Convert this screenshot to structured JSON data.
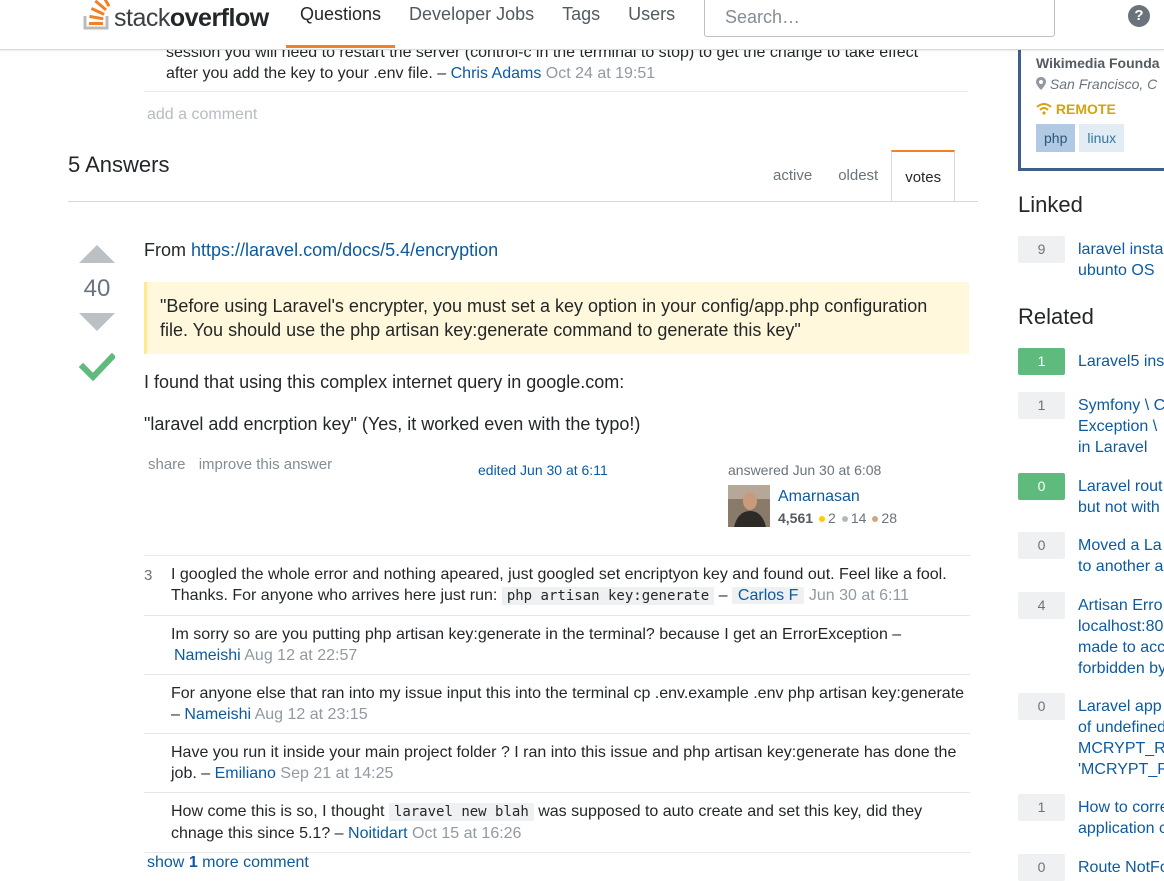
{
  "header": {
    "logo_prefix": "stack",
    "logo_bold": "overflow",
    "nav": [
      "Questions",
      "Developer Jobs",
      "Tags",
      "Users"
    ],
    "search_placeholder": "Search…",
    "help": "?"
  },
  "prev_comment": {
    "line1": "session you will need to restart the server (control-c in the terminal to stop) to get the change to take effect",
    "line2": "after you add the key to your .env file. –",
    "user": "Chris Adams",
    "time": "Oct 24 at 19:51"
  },
  "add_comment": "add a comment",
  "answers_header": "5 Answers",
  "sort_tabs": [
    "active",
    "oldest",
    "votes"
  ],
  "answer": {
    "votes": "40",
    "from_label": "From",
    "from_link": "https://laravel.com/docs/5.4/encryption",
    "quote": "\"Before using Laravel's encrypter, you must set a key option in your config/app.php configuration file. You should use the php artisan key:generate command to generate this key\"",
    "p1": "I found that using this complex internet query in google.com:",
    "p2": "\"laravel add encrption key\" (Yes, it worked even with the typo!)",
    "share": "share",
    "improve": "improve this answer",
    "edited": "edited Jun 30 at 6:11",
    "answered": "answered Jun 30 at 6:08",
    "user": "Amarnasan",
    "rep": "4,561",
    "gold": "2",
    "silver": "14",
    "bronze": "28"
  },
  "comments": [
    {
      "score": "3",
      "text_a": "I googled the whole error and nothing apeared, just googled set encriptyon key and found out. Feel like a fool. Thanks. For anyone who arrives here just run:",
      "code": "php artisan key:generate",
      "text_b": " –",
      "user": "Carlos F",
      "time": "Jun 30 at 6:11"
    },
    {
      "score": "",
      "text_a": "Im sorry so are you putting php artisan key:generate in the terminal? because I get an ErrorException –",
      "user": "Nameishi",
      "time": "Aug 12 at 22:57"
    },
    {
      "score": "",
      "text_a": "For anyone else that ran into my issue input this into the terminal cp .env.example .env php artisan key:generate –",
      "user": "Nameishi",
      "time": "Aug 12 at 23:15"
    },
    {
      "score": "",
      "text_a": "Have you run it inside your main project folder ? I ran into this issue and php artisan key:generate has done the job. –",
      "user": "Emiliano",
      "time": "Sep 21 at 14:25"
    },
    {
      "score": "",
      "text_a": "How come this is so, I thought",
      "code": "laravel new blah",
      "text_b": "was supposed to auto create and set this key, did they chnage this since 5.1? –",
      "user": "Noitidart",
      "time": "Oct 15 at 16:26"
    }
  ],
  "show_more": {
    "a": "show",
    "b": "1",
    "c": "more comment"
  },
  "job": {
    "company": "Wikimedia Founda",
    "location": "San Francisco, C",
    "remote": "REMOTE",
    "tags": [
      "php",
      "linux"
    ]
  },
  "linked": {
    "title": "Linked",
    "items": [
      {
        "count": "9",
        "lines": [
          "laravel insta",
          "ubunto OS"
        ]
      }
    ]
  },
  "related": {
    "title": "Related",
    "items": [
      {
        "count": "1",
        "accepted": true,
        "lines": [
          "Laravel5 ins"
        ]
      },
      {
        "count": "1",
        "accepted": false,
        "lines": [
          "Symfony \\ C",
          "Exception \\",
          "in Laravel"
        ]
      },
      {
        "count": "0",
        "accepted": true,
        "lines": [
          "Laravel rout",
          "but not with"
        ]
      },
      {
        "count": "0",
        "accepted": false,
        "lines": [
          "Moved a La",
          "to another a"
        ]
      },
      {
        "count": "4",
        "accepted": false,
        "lines": [
          "Artisan Erro",
          "localhost:80",
          "made to acc",
          "forbidden by"
        ]
      },
      {
        "count": "0",
        "accepted": false,
        "lines": [
          "Laravel app",
          "of undefined",
          "MCRYPT_R",
          "'MCRYPT_R"
        ]
      },
      {
        "count": "1",
        "accepted": false,
        "lines": [
          "How to corre",
          "application c"
        ]
      },
      {
        "count": "0",
        "accepted": false,
        "lines": [
          "Route NotFo"
        ]
      }
    ]
  },
  "colors": {
    "accent": "#f48024",
    "link": "#0c5ba1",
    "accepted": "#5eba7d",
    "quote_bg": "#fff8dc",
    "job_border": "#3e5f8a"
  }
}
